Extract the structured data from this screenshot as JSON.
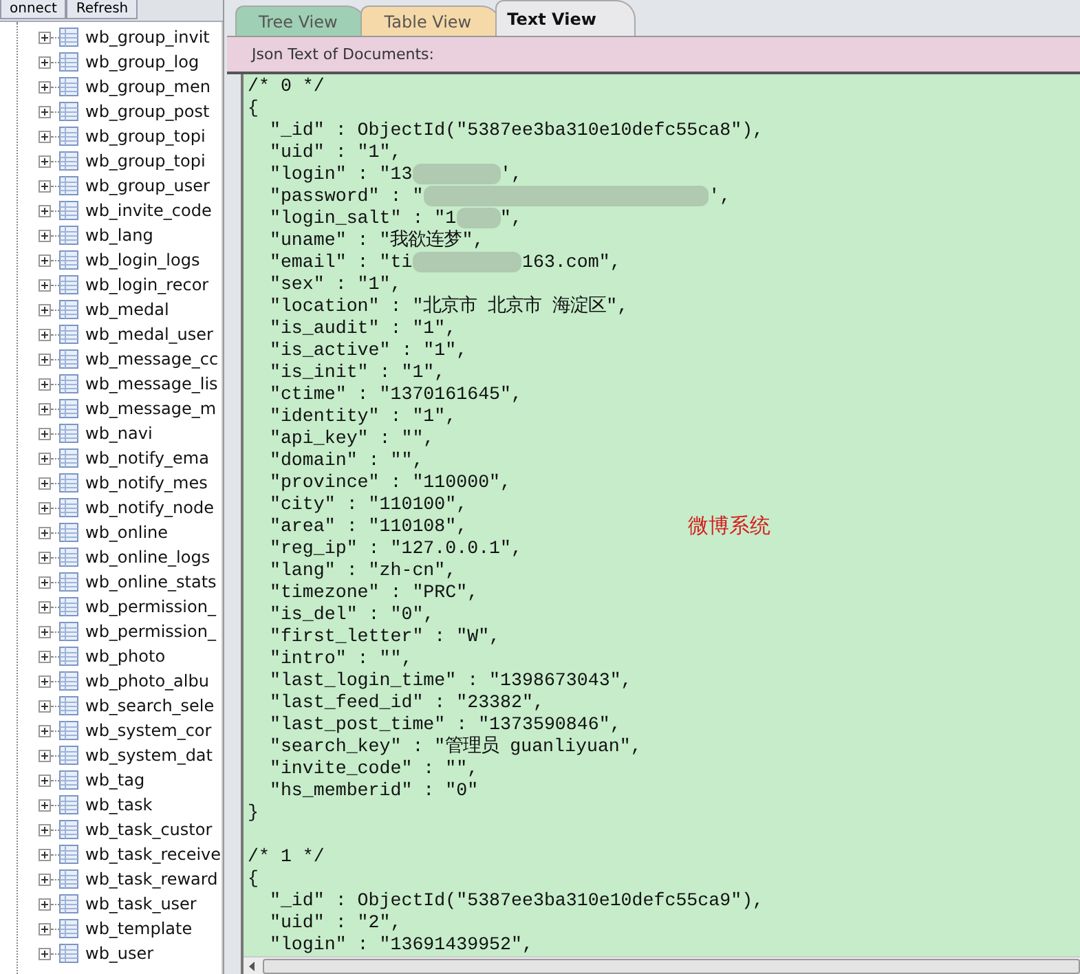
{
  "toolbar": {
    "buttons": [
      {
        "label": "onnect"
      },
      {
        "label": "Refresh"
      }
    ]
  },
  "tree": {
    "items": [
      {
        "label": "wb_group_invit"
      },
      {
        "label": "wb_group_log"
      },
      {
        "label": "wb_group_men"
      },
      {
        "label": "wb_group_post"
      },
      {
        "label": "wb_group_topi"
      },
      {
        "label": "wb_group_topi"
      },
      {
        "label": "wb_group_user"
      },
      {
        "label": "wb_invite_code"
      },
      {
        "label": "wb_lang"
      },
      {
        "label": "wb_login_logs"
      },
      {
        "label": "wb_login_recor"
      },
      {
        "label": "wb_medal"
      },
      {
        "label": "wb_medal_user"
      },
      {
        "label": "wb_message_cc"
      },
      {
        "label": "wb_message_lis"
      },
      {
        "label": "wb_message_m"
      },
      {
        "label": "wb_navi"
      },
      {
        "label": "wb_notify_ema"
      },
      {
        "label": "wb_notify_mes"
      },
      {
        "label": "wb_notify_node"
      },
      {
        "label": "wb_online"
      },
      {
        "label": "wb_online_logs"
      },
      {
        "label": "wb_online_stats"
      },
      {
        "label": "wb_permission_"
      },
      {
        "label": "wb_permission_"
      },
      {
        "label": "wb_photo"
      },
      {
        "label": "wb_photo_albu"
      },
      {
        "label": "wb_search_sele"
      },
      {
        "label": "wb_system_cor"
      },
      {
        "label": "wb_system_dat"
      },
      {
        "label": "wb_tag"
      },
      {
        "label": "wb_task"
      },
      {
        "label": "wb_task_custor"
      },
      {
        "label": "wb_task_receive"
      },
      {
        "label": "wb_task_reward"
      },
      {
        "label": "wb_task_user"
      },
      {
        "label": "wb_template"
      },
      {
        "label": "wb_user"
      }
    ]
  },
  "tabs": [
    {
      "label": "Tree View",
      "selected": false,
      "color": "#9fcfb4"
    },
    {
      "label": "Table View",
      "selected": false,
      "color": "#f5d9a8"
    },
    {
      "label": "Text View",
      "selected": true,
      "color": "#e9e9ec"
    }
  ],
  "panel": {
    "title": "Json Text of Documents:",
    "overlay_note": "微博系统",
    "lines": [
      {
        "kind": "plain",
        "text": "/* 0 */"
      },
      {
        "kind": "plain",
        "text": "{"
      },
      {
        "kind": "plain",
        "text": "  \"_id\" : ObjectId(\"5387ee3ba310e10defc55ca8\"),"
      },
      {
        "kind": "plain",
        "text": "  \"uid\" : \"1\","
      },
      {
        "kind": "redacted",
        "before": "  \"login\" : \"13",
        "after": "',"
      },
      {
        "kind": "redacted",
        "before": "  \"password\" : \"",
        "after": "',"
      },
      {
        "kind": "redacted",
        "before": "  \"login_salt\" : \"1",
        "after": "\","
      },
      {
        "kind": "plain",
        "text": "  \"uname\" : \"我欲连梦\","
      },
      {
        "kind": "redacted",
        "before": "  \"email\" : \"ti",
        "after": "163.com\","
      },
      {
        "kind": "plain",
        "text": "  \"sex\" : \"1\","
      },
      {
        "kind": "plain",
        "text": "  \"location\" : \"北京市 北京市 海淀区\","
      },
      {
        "kind": "plain",
        "text": "  \"is_audit\" : \"1\","
      },
      {
        "kind": "plain",
        "text": "  \"is_active\" : \"1\","
      },
      {
        "kind": "plain",
        "text": "  \"is_init\" : \"1\","
      },
      {
        "kind": "plain",
        "text": "  \"ctime\" : \"1370161645\","
      },
      {
        "kind": "plain",
        "text": "  \"identity\" : \"1\","
      },
      {
        "kind": "plain",
        "text": "  \"api_key\" : \"\","
      },
      {
        "kind": "plain",
        "text": "  \"domain\" : \"\","
      },
      {
        "kind": "plain",
        "text": "  \"province\" : \"110000\","
      },
      {
        "kind": "plain",
        "text": "  \"city\" : \"110100\","
      },
      {
        "kind": "plain",
        "text": "  \"area\" : \"110108\","
      },
      {
        "kind": "plain",
        "text": "  \"reg_ip\" : \"127.0.0.1\","
      },
      {
        "kind": "plain",
        "text": "  \"lang\" : \"zh-cn\","
      },
      {
        "kind": "plain",
        "text": "  \"timezone\" : \"PRC\","
      },
      {
        "kind": "plain",
        "text": "  \"is_del\" : \"0\","
      },
      {
        "kind": "plain",
        "text": "  \"first_letter\" : \"W\","
      },
      {
        "kind": "plain",
        "text": "  \"intro\" : \"\","
      },
      {
        "kind": "plain",
        "text": "  \"last_login_time\" : \"1398673043\","
      },
      {
        "kind": "plain",
        "text": "  \"last_feed_id\" : \"23382\","
      },
      {
        "kind": "plain",
        "text": "  \"last_post_time\" : \"1373590846\","
      },
      {
        "kind": "plain",
        "text": "  \"search_key\" : \"管理员 guanliyuan\","
      },
      {
        "kind": "plain",
        "text": "  \"invite_code\" : \"\","
      },
      {
        "kind": "plain",
        "text": "  \"hs_memberid\" : \"0\""
      },
      {
        "kind": "plain",
        "text": "}"
      },
      {
        "kind": "blank"
      },
      {
        "kind": "plain",
        "text": "/* 1 */"
      },
      {
        "kind": "plain",
        "text": "{"
      },
      {
        "kind": "plain",
        "text": "  \"_id\" : ObjectId(\"5387ee3ba310e10defc55ca9\"),"
      },
      {
        "kind": "plain",
        "text": "  \"uid\" : \"2\","
      },
      {
        "kind": "plain",
        "text": "  \"login\" : \"13691439952\","
      }
    ]
  }
}
